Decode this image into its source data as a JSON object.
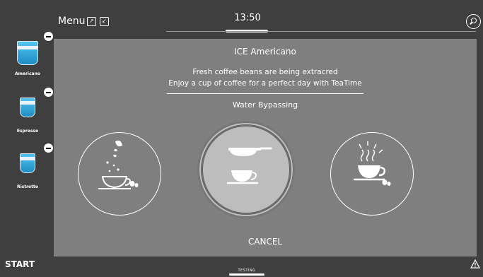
{
  "header": {
    "menu_label": "Menu",
    "clock": "13:50"
  },
  "drinks": [
    {
      "label": "Americano",
      "color": "#3aa7dc"
    },
    {
      "label": "Espresso",
      "color": "#3aa7dc"
    },
    {
      "label": "Ristretto",
      "color": "#3aa7dc"
    }
  ],
  "footer": {
    "start_label": "START",
    "indicator_label": "TESTING"
  },
  "dialog": {
    "title": "ICE Americano",
    "message_line1": "Fresh coffee beans are being extracred",
    "message_line2": "Enjoy a cup of coffee for a perfect day with TeaTime",
    "status": "Water Bypassing",
    "cancel_label": "CANCEL",
    "stages": [
      {
        "name": "grinding",
        "icon": "beans-into-cup-icon",
        "active": false
      },
      {
        "name": "extracting",
        "icon": "portafilter-cup-icon",
        "active": true
      },
      {
        "name": "serving",
        "icon": "hot-cup-icon",
        "active": false
      }
    ]
  },
  "colors": {
    "background": "#3f3f3f",
    "dialog": "#7f7f7f",
    "active_stage": "#bdbdbd",
    "accent_cup": "#3aa7dc"
  }
}
